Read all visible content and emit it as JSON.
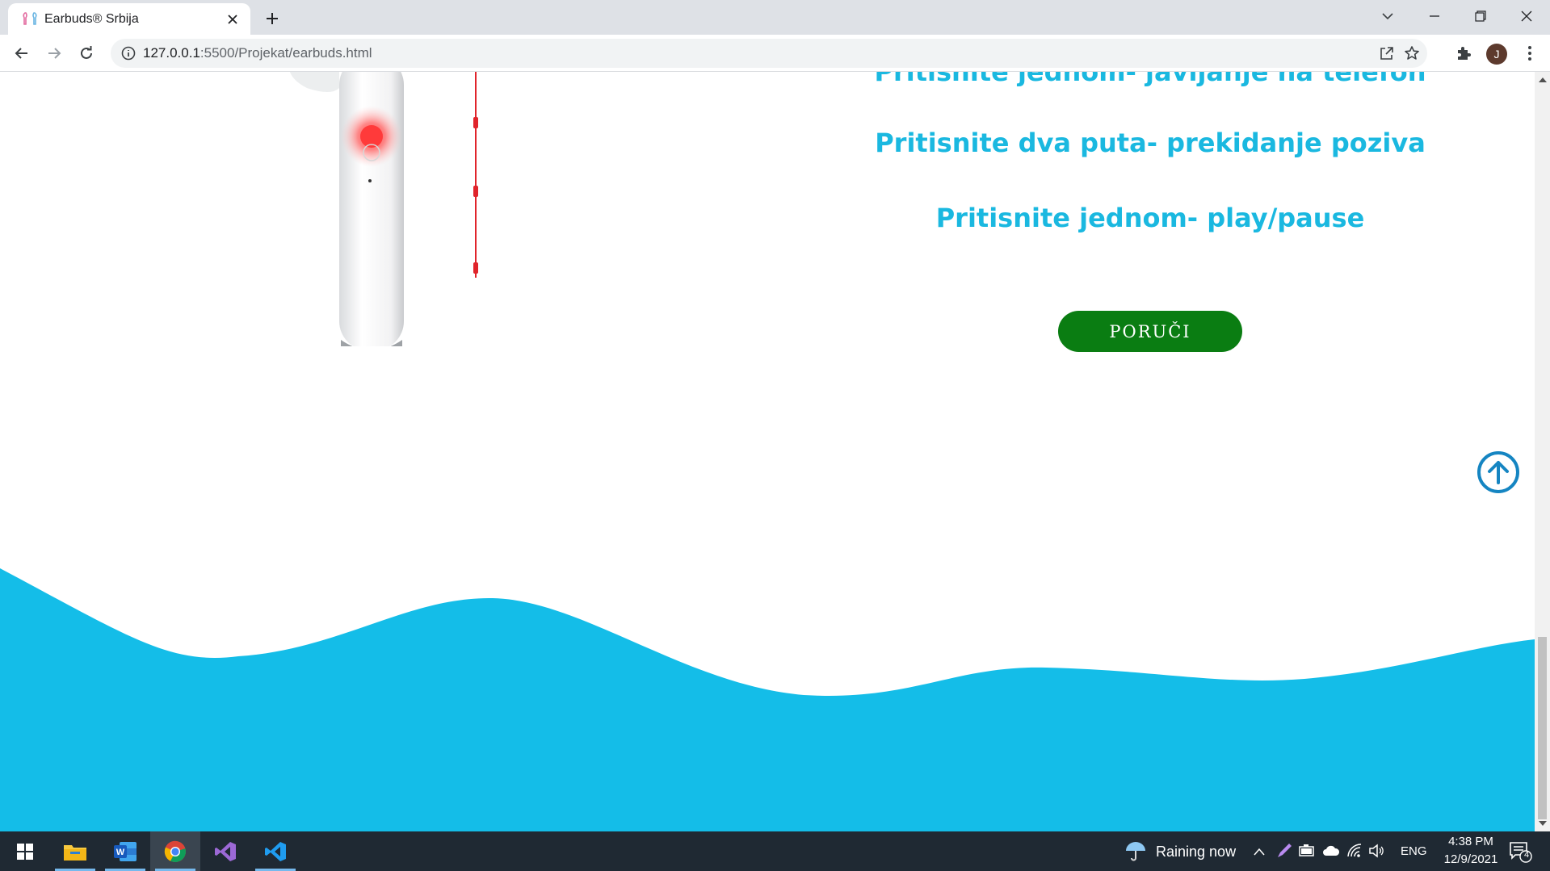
{
  "browser": {
    "tab_title": "Earbuds® Srbija",
    "url_host": "127.0.0.1",
    "url_path": ":5500/Projekat/earbuds.html",
    "avatar_initial": "J"
  },
  "page": {
    "instructions": [
      "Pritisnite jednom- javljanje na telefon",
      "Pritisnite dva puta- prekidanje poziva",
      "Pritisnite jednom- play/pause"
    ],
    "order_button": "PORUČI",
    "accent_color": "#1ab8e0",
    "wave_color": "#14bde8",
    "button_color": "#0a7d12"
  },
  "taskbar": {
    "weather": "Raining now",
    "language": "ENG",
    "time": "4:38 PM",
    "date": "12/9/2021",
    "notification_count": "4"
  }
}
